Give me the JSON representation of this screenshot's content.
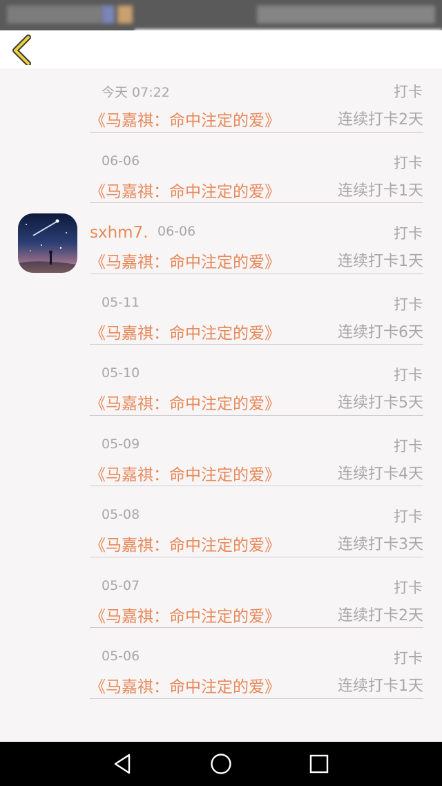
{
  "entries": [
    {
      "date": "今天 07:22",
      "tag": "打卡",
      "book": "《马嘉祺：命中注定的爱》",
      "streak": "连续打卡2天"
    },
    {
      "date": "06-06",
      "tag": "打卡",
      "book": "《马嘉祺：命中注定的爱》",
      "streak": "连续打卡1天"
    },
    {
      "user": "sxhm7.",
      "date": "06-06",
      "tag": "打卡",
      "book": "《马嘉祺：命中注定的爱》",
      "streak": "连续打卡1天"
    },
    {
      "date": "05-11",
      "tag": "打卡",
      "book": "《马嘉祺：命中注定的爱》",
      "streak": "连续打卡6天"
    },
    {
      "date": "05-10",
      "tag": "打卡",
      "book": "《马嘉祺：命中注定的爱》",
      "streak": "连续打卡5天"
    },
    {
      "date": "05-09",
      "tag": "打卡",
      "book": "《马嘉祺：命中注定的爱》",
      "streak": "连续打卡4天"
    },
    {
      "date": "05-08",
      "tag": "打卡",
      "book": "《马嘉祺：命中注定的爱》",
      "streak": "连续打卡3天"
    },
    {
      "date": "05-07",
      "tag": "打卡",
      "book": "《马嘉祺：命中注定的爱》",
      "streak": "连续打卡2天"
    },
    {
      "date": "05-06",
      "tag": "打卡",
      "book": "《马嘉祺：命中注定的爱》",
      "streak": "连续打卡1天"
    }
  ],
  "icons": {
    "back": "chevron-left-icon",
    "nav_back": "triangle-back-icon",
    "nav_home": "circle-home-icon",
    "nav_recents": "square-recents-icon"
  },
  "colors": {
    "accent": "#e8895a",
    "muted_text": "#a8a8a8",
    "background": "#f7f5f6",
    "back_icon": "#f2d23a"
  }
}
